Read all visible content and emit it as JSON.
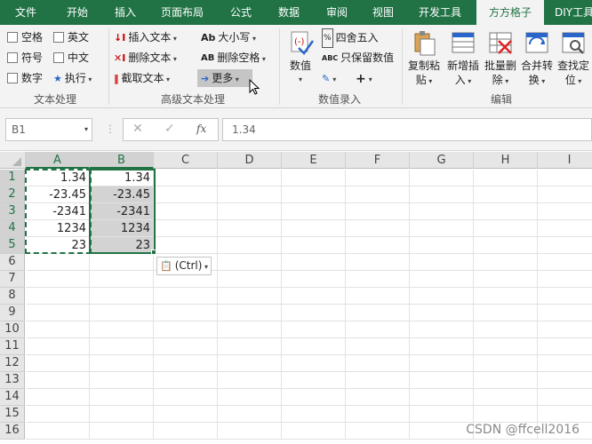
{
  "tabs": [
    "文件",
    "开始",
    "插入",
    "页面布局",
    "公式",
    "数据",
    "审阅",
    "视图",
    "开发工具",
    "方方格子",
    "DIY工具"
  ],
  "active_tab": "方方格子",
  "ribbon": {
    "text_group": {
      "checks": [
        "空格",
        "英文",
        "符号",
        "中文",
        "数字"
      ],
      "execute": "执行",
      "label": "文本处理"
    },
    "advanced_group": {
      "insert_text": "插入文本",
      "delete_text": "删除文本",
      "extract_text": "截取文本",
      "case": "大小写",
      "case_icon": "Ab",
      "delete_space": "删除空格",
      "delete_space_icon": "AB",
      "more": "更多",
      "label": "高级文本处理"
    },
    "value_group": {
      "value": "数值",
      "round": "四舍五入",
      "keep_value": "只保留数值",
      "keep_value_icon": "ABC",
      "label": "数值录入"
    },
    "edit_group": {
      "buttons": [
        [
          "复制粘",
          "贴"
        ],
        [
          "新增插",
          "入"
        ],
        [
          "批量删",
          "除"
        ],
        [
          "合并转",
          "换"
        ],
        [
          "查找定",
          "位"
        ]
      ],
      "label": "编辑"
    }
  },
  "formula_bar": {
    "name_box": "B1",
    "fx": "fx",
    "value": "1.34"
  },
  "columns": [
    "A",
    "B",
    "C",
    "D",
    "E",
    "F",
    "G",
    "H",
    "I"
  ],
  "rows": [
    "1",
    "2",
    "3",
    "4",
    "5",
    "6",
    "7",
    "8",
    "9",
    "10",
    "11",
    "12",
    "13",
    "14",
    "15",
    "16"
  ],
  "cells": {
    "A": [
      "1.34",
      "-23.45",
      "-2341",
      "1234",
      "23"
    ],
    "B": [
      "1.34",
      "-23.45",
      "-2341",
      "1234",
      "23"
    ]
  },
  "paste_options": {
    "label": "(Ctrl)"
  },
  "watermark": "CSDN @ffcell2016",
  "colors": {
    "accent": "#217346",
    "selection_fill": "#d3d3d3"
  }
}
